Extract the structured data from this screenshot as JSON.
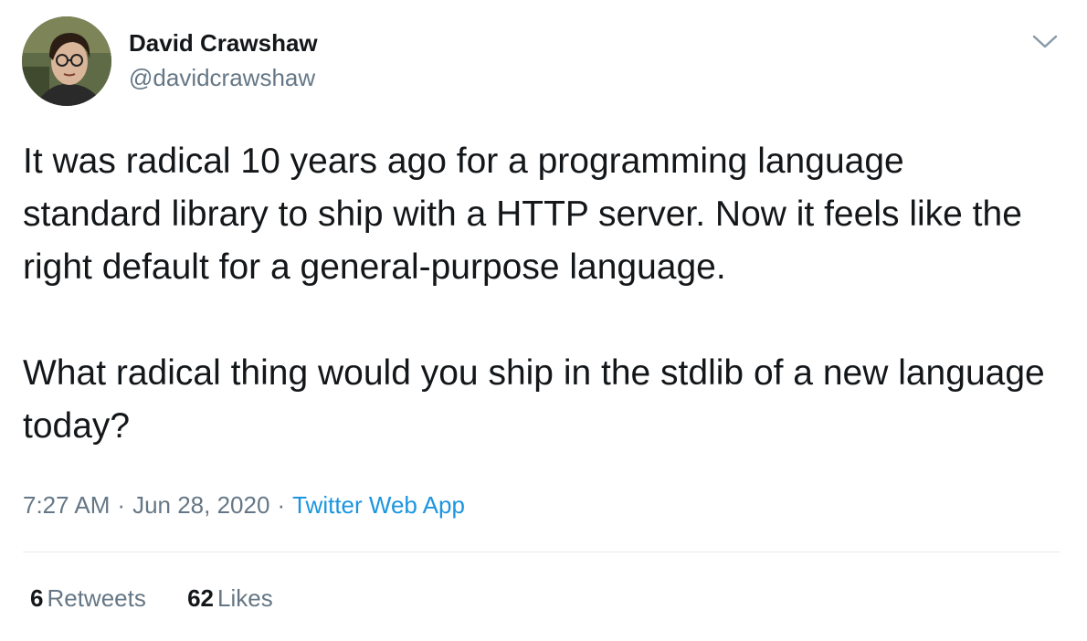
{
  "author": {
    "name": "David Crawshaw",
    "handle": "@davidcrawshaw"
  },
  "tweet": {
    "paragraphs": [
      "It was radical 10 years ago for a programming language standard library to ship with a HTTP server. Now it feels like the right default for a general-purpose language.",
      "What radical thing would you ship in the stdlib of a new language today?"
    ]
  },
  "meta": {
    "time": "7:27 AM",
    "separator": "·",
    "date": "Jun 28, 2020",
    "source": "Twitter Web App"
  },
  "stats": {
    "retweets_count": "6",
    "retweets_label": "Retweets",
    "likes_count": "62",
    "likes_label": "Likes"
  },
  "icons": {
    "menu": "chevron-down-icon"
  },
  "colors": {
    "text": "#14171a",
    "secondary": "#657786",
    "link": "#1b95e0",
    "divider": "#e6ecf0"
  }
}
